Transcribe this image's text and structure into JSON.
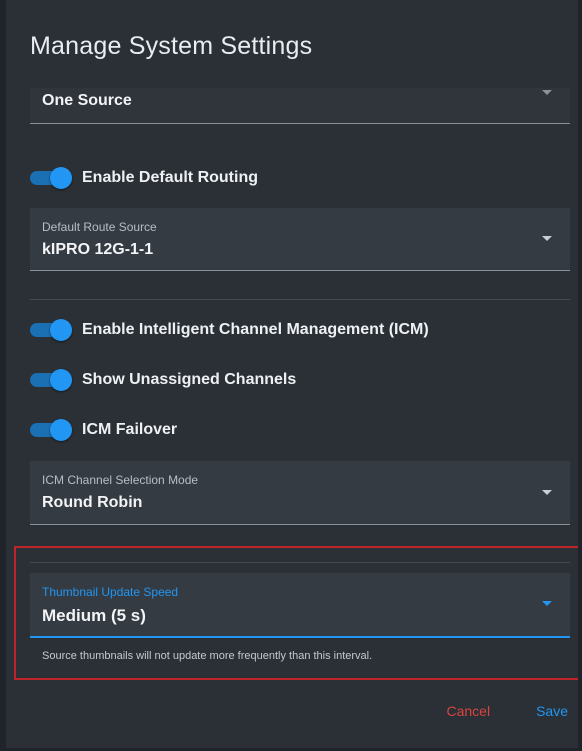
{
  "dialog": {
    "title": "Manage System Settings"
  },
  "fields": {
    "source_mode": {
      "value": "One Source"
    },
    "enable_default_routing": {
      "label": "Enable Default Routing",
      "checked": true
    },
    "default_route_source": {
      "label": "Default Route Source",
      "value": "kIPRO 12G-1-1"
    },
    "enable_icm": {
      "label": "Enable Intelligent Channel Management (ICM)",
      "checked": true
    },
    "show_unassigned": {
      "label": "Show Unassigned Channels",
      "checked": true
    },
    "icm_failover": {
      "label": "ICM Failover",
      "checked": true
    },
    "icm_selection_mode": {
      "label": "ICM Channel Selection Mode",
      "value": "Round Robin"
    },
    "thumbnail_speed": {
      "label": "Thumbnail Update Speed",
      "value": "Medium (5 s)",
      "helper": "Source thumbnails will not update more frequently than this interval."
    }
  },
  "actions": {
    "cancel_label": "Cancel",
    "save_label": "Save"
  },
  "colors": {
    "accent": "#2196f3",
    "danger": "#d9453f",
    "highlight_border": "#c0242b",
    "dialog_bg": "#2b3036"
  }
}
